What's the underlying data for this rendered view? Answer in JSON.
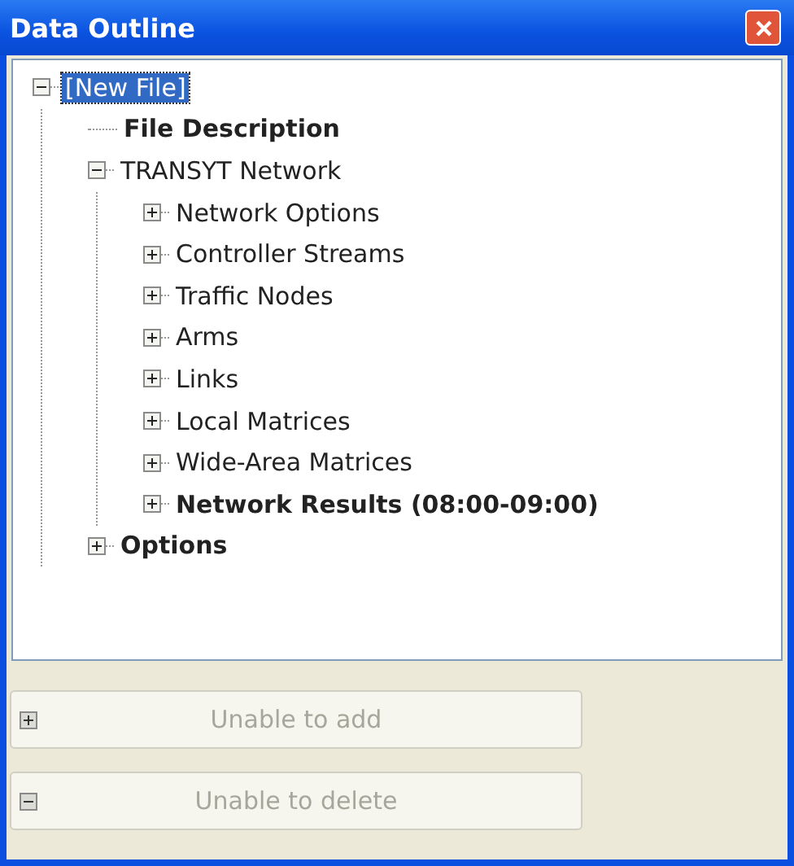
{
  "window": {
    "title": "Data Outline"
  },
  "tree": [
    {
      "label": "[New File]",
      "expanded": true,
      "selected": true,
      "bold": false,
      "children": [
        {
          "label": "File Description",
          "selected": false,
          "bold": true
        },
        {
          "label": "TRANSYT Network",
          "expanded": true,
          "selected": false,
          "bold": false,
          "children": [
            {
              "label": "Network Options",
              "expanded": false,
              "selected": false,
              "bold": false
            },
            {
              "label": "Controller Streams",
              "expanded": false,
              "selected": false,
              "bold": false
            },
            {
              "label": "Traffic Nodes",
              "expanded": false,
              "selected": false,
              "bold": false
            },
            {
              "label": "Arms",
              "expanded": false,
              "selected": false,
              "bold": false
            },
            {
              "label": "Links",
              "expanded": false,
              "selected": false,
              "bold": false
            },
            {
              "label": "Local Matrices",
              "expanded": false,
              "selected": false,
              "bold": false
            },
            {
              "label": "Wide-Area Matrices",
              "expanded": false,
              "selected": false,
              "bold": false
            },
            {
              "label": "Network Results (08:00-09:00)",
              "expanded": false,
              "selected": false,
              "bold": true
            }
          ]
        },
        {
          "label": "Options",
          "expanded": false,
          "selected": false,
          "bold": true
        }
      ]
    }
  ],
  "buttons": [
    {
      "kind": "add",
      "label": "Unable to add",
      "disabled": true
    },
    {
      "kind": "delete",
      "label": "Unable to delete",
      "disabled": true
    }
  ]
}
